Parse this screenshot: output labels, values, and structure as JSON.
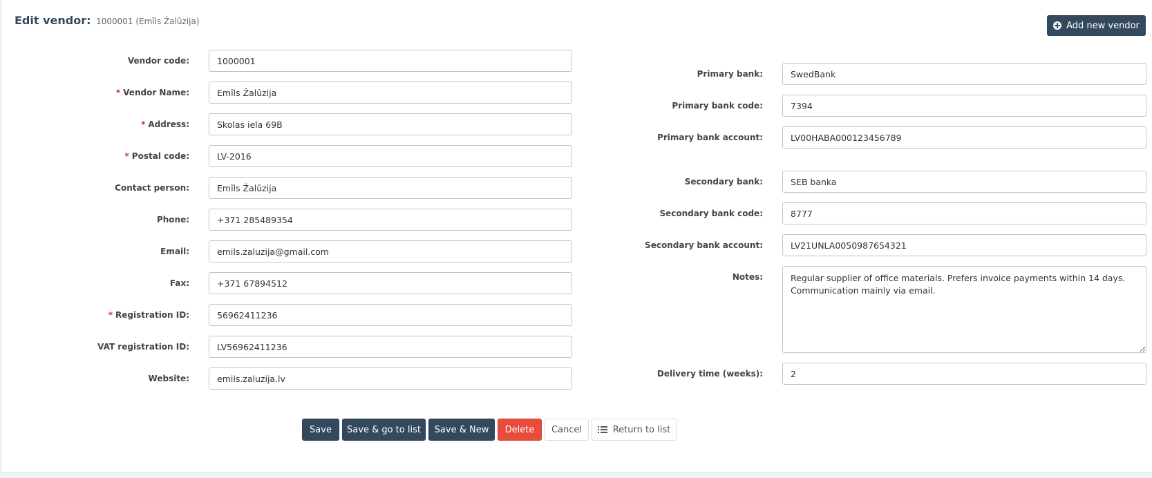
{
  "header": {
    "title": "Edit vendor:",
    "subtitle": "1000001 (Emīls Žalūzija)",
    "add_button": "Add new vendor"
  },
  "left_fields": [
    {
      "label": "Vendor code:",
      "value": "1000001",
      "required": false
    },
    {
      "label": "Vendor Name:",
      "value": "Emīls Žalūzija",
      "required": true
    },
    {
      "label": "Address:",
      "value": "Skolas iela 69B",
      "required": true
    },
    {
      "label": "Postal code:",
      "value": "LV-2016",
      "required": true
    },
    {
      "label": "Contact person:",
      "value": "Emīls Žalūzija",
      "required": false
    },
    {
      "label": "Phone:",
      "value": "+371 285489354",
      "required": false
    },
    {
      "label": "Email:",
      "value": "emils.zaluzija@gmail.com",
      "required": false
    },
    {
      "label": "Fax:",
      "value": "+371 67894512",
      "required": false
    },
    {
      "label": "Registration ID:",
      "value": "56962411236",
      "required": true
    },
    {
      "label": "VAT registration ID:",
      "value": "LV56962411236",
      "required": false
    },
    {
      "label": "Website:",
      "value": "emils.zaluzija.lv",
      "required": false
    }
  ],
  "right_fields": {
    "primary_bank": {
      "label": "Primary bank:",
      "value": "SwedBank"
    },
    "primary_bank_code": {
      "label": "Primary bank code:",
      "value": "7394"
    },
    "primary_bank_account": {
      "label": "Primary bank account:",
      "value": "LV00HABA000123456789"
    },
    "secondary_bank": {
      "label": "Secondary bank:",
      "value": "SEB banka"
    },
    "secondary_bank_code": {
      "label": "Secondary bank code:",
      "value": "8777"
    },
    "secondary_bank_account": {
      "label": "Secondary bank account:",
      "value": "LV21UNLA0050987654321"
    },
    "notes": {
      "label": "Notes:",
      "value": "Regular supplier of office materials. Prefers invoice payments within 14 days. Communication mainly via email."
    },
    "delivery_time": {
      "label": "Delivery time (weeks):",
      "value": "2"
    }
  },
  "required_marker": "*",
  "actions": {
    "save": "Save",
    "save_go_list": "Save & go to list",
    "save_new": "Save & New",
    "delete": "Delete",
    "cancel": "Cancel",
    "return_list": "Return to list"
  },
  "colors": {
    "primary": "#34495e",
    "danger": "#e74c3c",
    "required": "#c0392b"
  }
}
